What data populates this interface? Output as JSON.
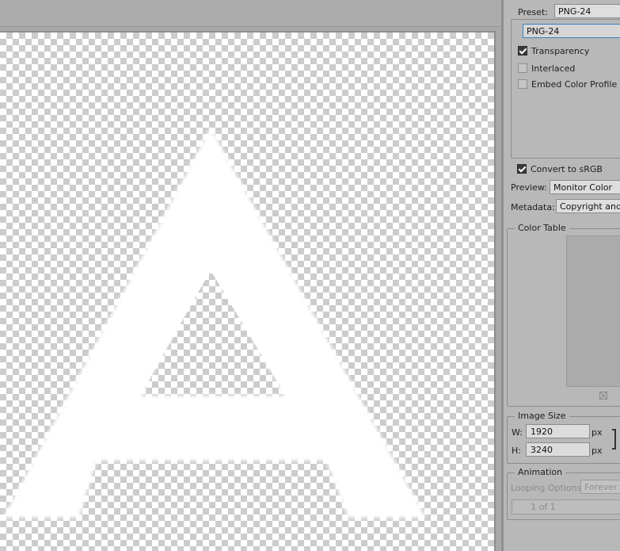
{
  "preset": {
    "label": "Preset:",
    "value": "PNG-24"
  },
  "format": {
    "value": "PNG-24"
  },
  "options": {
    "transparency": {
      "label": "Transparency",
      "checked": true
    },
    "interlaced": {
      "label": "Interlaced",
      "checked": false
    },
    "embed_color_profile": {
      "label": "Embed Color Profile",
      "checked": false
    }
  },
  "convert_srgb": {
    "label": "Convert to sRGB",
    "checked": true
  },
  "preview": {
    "label": "Preview:",
    "value": "Monitor Color"
  },
  "metadata": {
    "label": "Metadata:",
    "value": "Copyright and C"
  },
  "color_table": {
    "title": "Color Table",
    "icon": "color-table-options-icon"
  },
  "image_size": {
    "title": "Image Size",
    "w_label": "W:",
    "w_value": "1920",
    "h_label": "H:",
    "h_value": "3240",
    "unit": "px",
    "link_icon": "link-bracket-icon"
  },
  "animation": {
    "title": "Animation",
    "looping_label": "Looping Options:",
    "looping_value": "Forever",
    "frame_counter": "1 of 1"
  },
  "canvas": {
    "background": "transparency-checkerboard",
    "artwork": "white-letter-A"
  },
  "colors": {
    "panel_bg": "#b8b8b8",
    "focus_border": "#3c7fc0",
    "artwork": "#ffffff"
  }
}
